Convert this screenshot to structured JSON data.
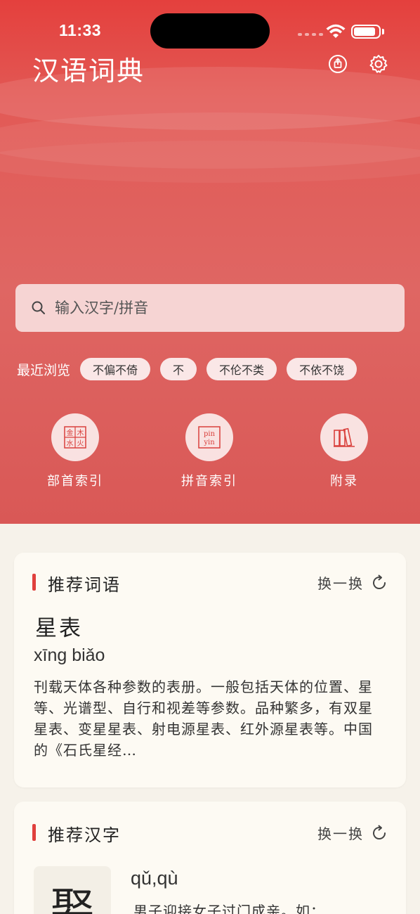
{
  "status_bar": {
    "time": "11:33"
  },
  "header": {
    "title": "汉语词典"
  },
  "search": {
    "placeholder": "输入汉字/拼音"
  },
  "recent": {
    "label": "最近浏览",
    "items": [
      "不偏不倚",
      "不",
      "不伦不类",
      "不依不饶"
    ]
  },
  "quick_links": [
    {
      "label": "部首索引",
      "icon": "radical-index-icon",
      "glyph": "金木水火"
    },
    {
      "label": "拼音索引",
      "icon": "pinyin-index-icon",
      "glyph": "pin yin"
    },
    {
      "label": "附录",
      "icon": "books-icon"
    }
  ],
  "recommended_word": {
    "section_title": "推荐词语",
    "refresh_label": "换一换",
    "word": "星表",
    "pinyin": "xīng biǎo",
    "definition": "刊载天体各种参数的表册。一般包括天体的位置、星等、光谱型、自行和视差等参数。品种繁多，有双星星表、变星星表、射电源星表、红外源星表等。中国的《石氏星经…"
  },
  "recommended_char": {
    "section_title": "推荐汉字",
    "refresh_label": "换一换",
    "char": "娶",
    "pinyin": "qǔ,qù",
    "definition": "男子迎接女子过门成亲。如："
  },
  "colors": {
    "accent": "#e0403d",
    "hero": "#df6663",
    "background": "#f6f2ea",
    "card": "#fdfaf3"
  }
}
